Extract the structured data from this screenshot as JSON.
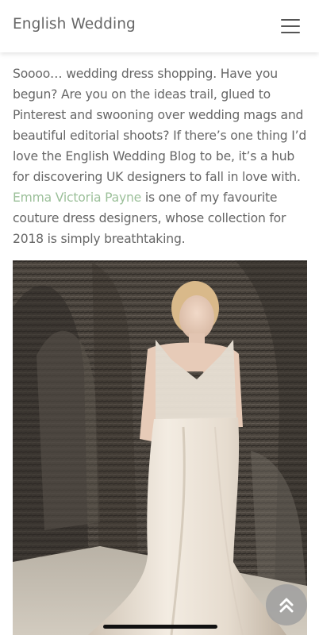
{
  "header": {
    "site_title": "English Wedding",
    "menu_icon": "hamburger-menu-icon"
  },
  "article": {
    "intro_before_link": "Soooo… wedding dress shopping. Have you begun? Are you on the ideas trail, glued to Pinterest and swooning over wedding mags and beautiful editorial shoots? If there’s one thing I’d love the English Wedding Blog to be, it’s a hub for discovering UK designers to fall in love with. ",
    "designer_link": "Emma Victoria Payne",
    "intro_after_link": " is one of my favourite couture dress designers, whose collection for 2018 is simply breathtaking."
  },
  "hero_image": {
    "subject": "bride-in-satin-gown-photo"
  },
  "controls": {
    "scroll_top_icon": "double-chevron-up-icon"
  },
  "colors": {
    "text": "#666666",
    "link": "#9cc09a",
    "header_bg": "#ffffff"
  }
}
